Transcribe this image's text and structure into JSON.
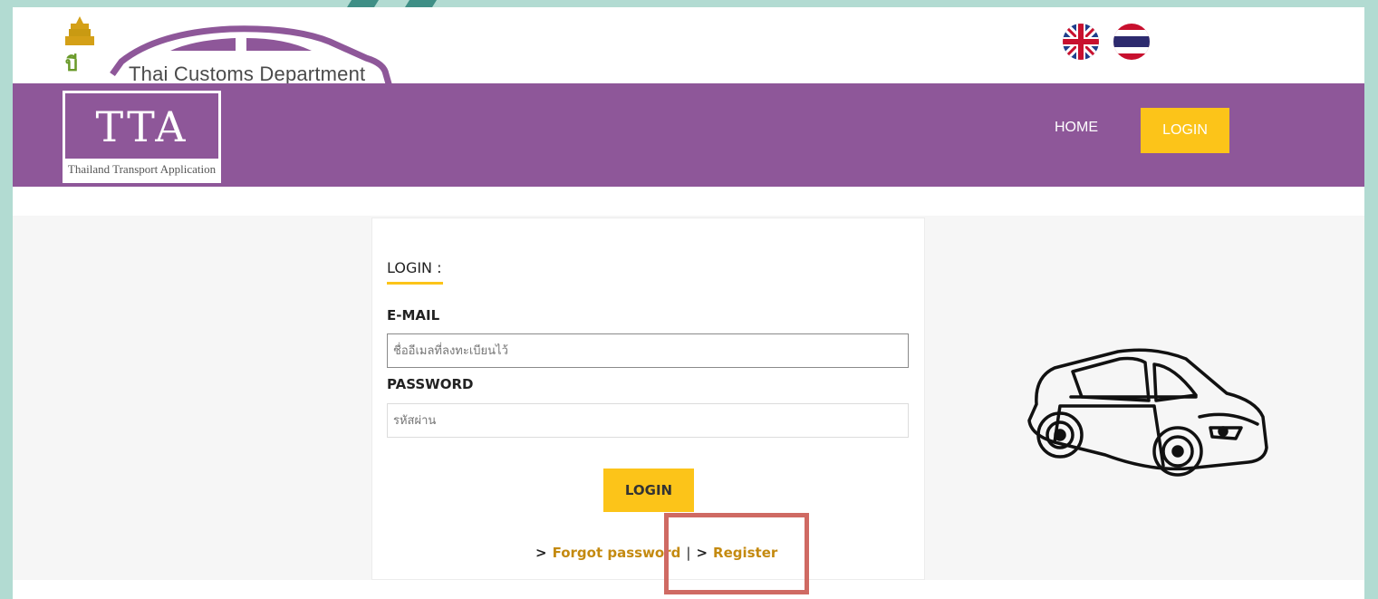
{
  "header": {
    "department": "Thai Customs Department",
    "languages": [
      "English",
      "Thai"
    ]
  },
  "nav": {
    "brand_title": "TTA",
    "brand_subtitle": "Thailand Transport Application",
    "home_label": "HOME",
    "login_label": "LOGIN"
  },
  "login_form": {
    "title": "LOGIN :",
    "email_label": "E-MAIL",
    "email_placeholder": "ชื่ออีเมลที่ลงทะเบียนไว้",
    "password_label": "PASSWORD",
    "password_placeholder": "รหัสผ่าน",
    "submit_label": "LOGIN",
    "forgot_label": "Forgot password",
    "separator": "|",
    "register_label": "Register"
  },
  "colors": {
    "nav_purple": "#8e5799",
    "accent_yellow": "#fcc419",
    "link_gold": "#c48a10",
    "highlight_red": "#cf6a63"
  }
}
